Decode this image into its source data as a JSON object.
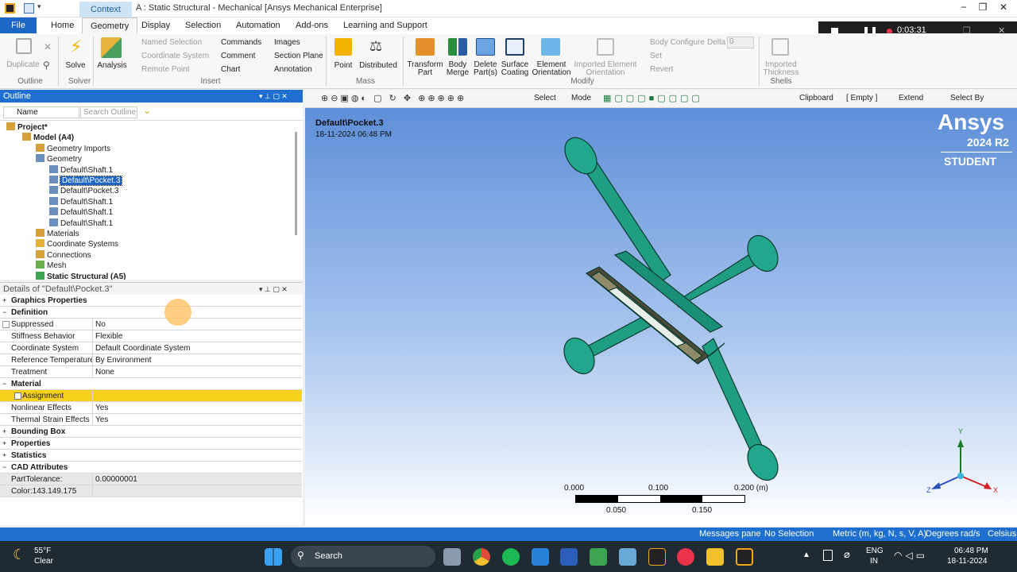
{
  "titlebar": {
    "context_tab": "Context",
    "title": "A : Static Structural - Mechanical [Ansys Mechanical Enterprise]"
  },
  "menu": [
    "File",
    "Home",
    "Geometry",
    "Display",
    "Selection",
    "Automation",
    "Add-ons",
    "Learning and Support"
  ],
  "ribbon": {
    "outline": {
      "duplicate": "Duplicate",
      "group": "Outline"
    },
    "solver": {
      "solve": "Solve",
      "group": "Solver"
    },
    "insert": {
      "analysis": "Analysis",
      "named_selection": "Named Selection",
      "coordinate_system": "Coordinate System",
      "remote_point": "Remote Point",
      "commands": "Commands",
      "comment": "Comment",
      "chart": "Chart",
      "images": "Images",
      "section_plane": "Section Plane",
      "annotation": "Annotation",
      "group": "Insert"
    },
    "mass": {
      "point": "Point",
      "distributed": "Distributed",
      "group": "Mass"
    },
    "modify": {
      "transform_part": "Transform Part",
      "body_merge": "Body Merge",
      "delete_parts": "Delete Part(s)",
      "surface_coating": "Surface Coating",
      "element_orientation": "Element Orientation",
      "imported_element_orientation": "Imported Element Orientation",
      "body_configure": "Body Configure",
      "delta": "Delta",
      "delta_value": "0",
      "set": "Set",
      "revert": "Revert",
      "group": "Modify"
    },
    "shells": {
      "imported_thickness": "Imported Thickness",
      "group": "Shells"
    }
  },
  "recording": {
    "time": "0:03:31"
  },
  "outline": {
    "title": "Outline",
    "filter": "Name",
    "search_placeholder": "Search Outline",
    "tree": [
      {
        "label": "Project*",
        "bold": true
      },
      {
        "label": "Model (A4)",
        "bold": true
      },
      {
        "label": "Geometry Imports"
      },
      {
        "label": "Geometry"
      },
      {
        "label": "Default\\Shaft.1"
      },
      {
        "label": "Default\\Pocket.3",
        "selected": true
      },
      {
        "label": "Default\\Pocket.3"
      },
      {
        "label": "Default\\Shaft.1"
      },
      {
        "label": "Default\\Shaft.1"
      },
      {
        "label": "Default\\Shaft.1"
      },
      {
        "label": "Materials"
      },
      {
        "label": "Coordinate Systems"
      },
      {
        "label": "Connections"
      },
      {
        "label": "Mesh"
      },
      {
        "label": "Static Structural (A5)",
        "bold": true
      }
    ]
  },
  "details": {
    "title": "Details of \"Default\\Pocket.3\"",
    "rows": [
      {
        "type": "section",
        "label": "Graphics Properties",
        "exp": "+"
      },
      {
        "type": "section",
        "label": "Definition",
        "exp": "−"
      },
      {
        "type": "row",
        "k": "Suppressed",
        "v": "No"
      },
      {
        "type": "row",
        "k": "Stiffness Behavior",
        "v": "Flexible"
      },
      {
        "type": "row",
        "k": "Coordinate System",
        "v": "Default Coordinate System"
      },
      {
        "type": "row",
        "k": "Reference Temperature",
        "v": "By Environment"
      },
      {
        "type": "row",
        "k": "Treatment",
        "v": "None"
      },
      {
        "type": "section",
        "label": "Material",
        "exp": "−"
      },
      {
        "type": "row",
        "k": "Assignment",
        "v": "",
        "highlight": true
      },
      {
        "type": "row",
        "k": "Nonlinear Effects",
        "v": "Yes"
      },
      {
        "type": "row",
        "k": "Thermal Strain Effects",
        "v": "Yes"
      },
      {
        "type": "section",
        "label": "Bounding Box",
        "exp": "+"
      },
      {
        "type": "section",
        "label": "Properties",
        "exp": "+"
      },
      {
        "type": "section",
        "label": "Statistics",
        "exp": "+"
      },
      {
        "type": "section",
        "label": "CAD Attributes",
        "exp": "−"
      },
      {
        "type": "row",
        "k": "PartTolerance:",
        "v": "0.00000001",
        "grey": true
      },
      {
        "type": "row",
        "k": "Color:143.149.175",
        "v": "",
        "grey": true
      }
    ]
  },
  "viewtoolbar": {
    "select": "Select",
    "mode": "Mode",
    "clipboard": "Clipboard",
    "empty": "[ Empty ]",
    "extend": "Extend",
    "select_by": "Select By"
  },
  "viewport": {
    "object": "Default\\Pocket.3",
    "timestamp": "18-11-2024 06:48 PM",
    "brand": "Ansys",
    "version": "2024 R2",
    "edition": "STUDENT",
    "scale_top": [
      "0.000",
      "0.100",
      "0.200 (m)"
    ],
    "scale_bottom": [
      "0.050",
      "0.150"
    ],
    "axes": {
      "x": "X",
      "y": "Y",
      "z": "Z"
    },
    "model_color": "#1f9e84"
  },
  "status": {
    "messages": "Messages pane",
    "selection": "No Selection",
    "units": "Metric (m, kg, N, s, V, A)",
    "angle": "Degrees",
    "rate": "rad/s",
    "temp": "Celsius"
  },
  "taskbar": {
    "weather_temp": "55°F",
    "weather_cond": "Clear",
    "search": "Search",
    "lang1": "ENG",
    "lang2": "IN",
    "time": "06:48 PM",
    "date": "18-11-2024"
  }
}
